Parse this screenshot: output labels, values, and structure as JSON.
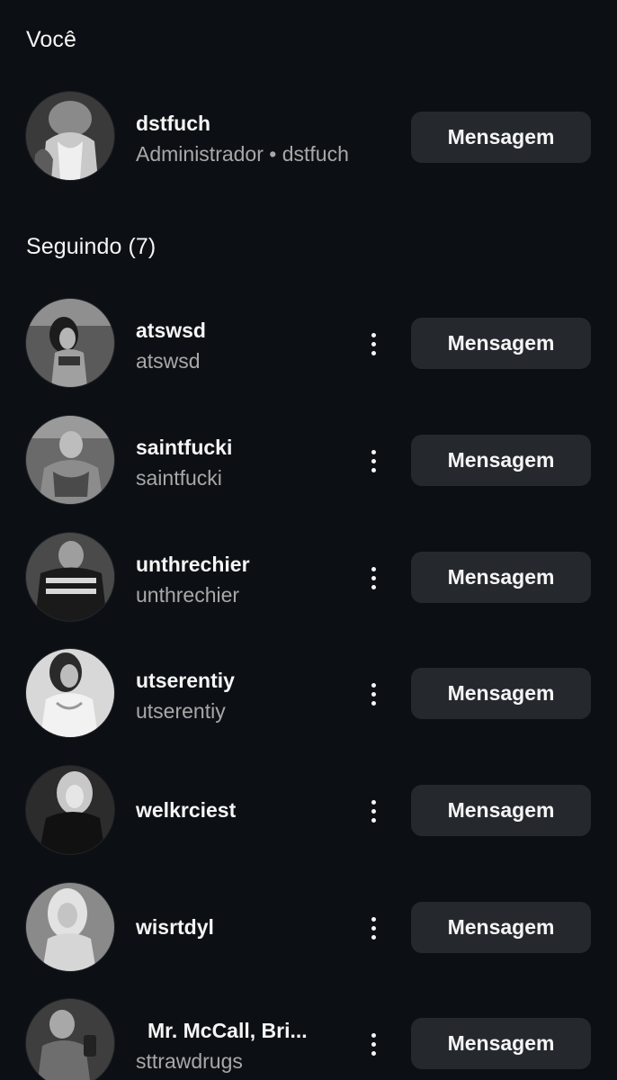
{
  "you_section": {
    "title": "Você",
    "user": {
      "username": "dstfuch",
      "subtitle": "Administrador • dstfuch",
      "button_label": "Mensagem"
    }
  },
  "following_section": {
    "title": "Seguindo (7)",
    "users": [
      {
        "username": "atswsd",
        "subtitle": "atswsd",
        "button_label": "Mensagem",
        "more_icon": "more-vertical-icon"
      },
      {
        "username": "saintfucki",
        "subtitle": "saintfucki",
        "button_label": "Mensagem",
        "more_icon": "more-vertical-icon"
      },
      {
        "username": "unthrechier",
        "subtitle": "unthrechier",
        "button_label": "Mensagem",
        "more_icon": "more-vertical-icon"
      },
      {
        "username": "utserentiy",
        "subtitle": "utserentiy",
        "button_label": "Mensagem",
        "more_icon": "more-vertical-icon"
      },
      {
        "username": "welkrciest",
        "subtitle": "",
        "button_label": "Mensagem",
        "more_icon": "more-vertical-icon"
      },
      {
        "username": "wisrtdyl",
        "subtitle": "",
        "button_label": "Mensagem",
        "more_icon": "more-vertical-icon"
      },
      {
        "username": " Mr. McCall, Bri...",
        "subtitle": "sttrawdrugs",
        "button_label": "Mensagem",
        "more_icon": "more-vertical-icon"
      }
    ]
  },
  "colors": {
    "background": "#0c1014",
    "button_bg": "#25292e",
    "primary_text": "#f5f5f5",
    "secondary_text": "#a8a8a8"
  }
}
